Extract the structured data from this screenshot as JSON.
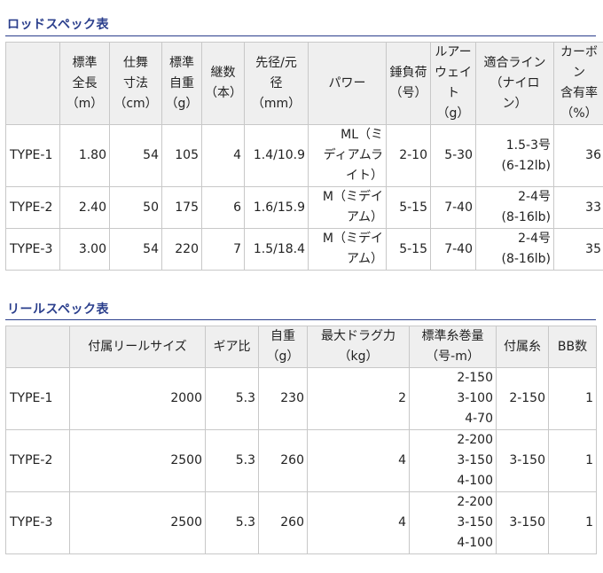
{
  "rod": {
    "title": "ロッドスペック表",
    "headers": [
      "",
      "標準\n全長\n（m）",
      "仕舞\n寸法\n（cm）",
      "標準\n自重\n（g）",
      "継数\n（本）",
      "先径/元\n径\n（mm）",
      "パワー",
      "錘負荷\n（号）",
      "ルアー\nウェイ\nト\n（g）",
      "適合ライン\n（ナイロ\nン）",
      "カーボ\nン\n含有率\n（%）"
    ],
    "rows": [
      {
        "name": "TYPE-1",
        "length": "1.80",
        "closed": "54",
        "weight": "105",
        "pieces": "4",
        "diameter": "1.4/10.9",
        "power": "ML（ミ\nディアムラ\nイト）",
        "sinker": "2-10",
        "lure": "5-30",
        "line": "1.5-3号\n(6-12lb)",
        "carbon": "36"
      },
      {
        "name": "TYPE-2",
        "length": "2.40",
        "closed": "50",
        "weight": "175",
        "pieces": "6",
        "diameter": "1.6/15.9",
        "power": "M（ミデイ\nアム）",
        "sinker": "5-15",
        "lure": "7-40",
        "line": "2-4号\n(8-16lb)",
        "carbon": "33"
      },
      {
        "name": "TYPE-3",
        "length": "3.00",
        "closed": "54",
        "weight": "220",
        "pieces": "7",
        "diameter": "1.5/18.4",
        "power": "M（ミデイ\nアム）",
        "sinker": "5-15",
        "lure": "7-40",
        "line": "2-4号\n(8-16lb)",
        "carbon": "35"
      }
    ]
  },
  "reel": {
    "title": "リールスペック表",
    "headers": [
      "",
      "付属リールサイズ",
      "ギア比",
      "自重\n（g）",
      "最大ドラグ力\n（kg）",
      "標準糸巻量\n（号-m）",
      "付属糸",
      "BB数"
    ],
    "rows": [
      {
        "name": "TYPE-1",
        "size": "2000",
        "gear": "5.3",
        "weight": "230",
        "drag": "2",
        "capacity": "2-150\n3-100\n4-70",
        "line": "2-150",
        "bb": "1"
      },
      {
        "name": "TYPE-2",
        "size": "2500",
        "gear": "5.3",
        "weight": "260",
        "drag": "4",
        "capacity": "2-200\n3-150\n4-100",
        "line": "3-150",
        "bb": "1"
      },
      {
        "name": "TYPE-3",
        "size": "2500",
        "gear": "5.3",
        "weight": "260",
        "drag": "4",
        "capacity": "2-200\n3-150\n4-100",
        "line": "3-150",
        "bb": "1"
      }
    ]
  }
}
